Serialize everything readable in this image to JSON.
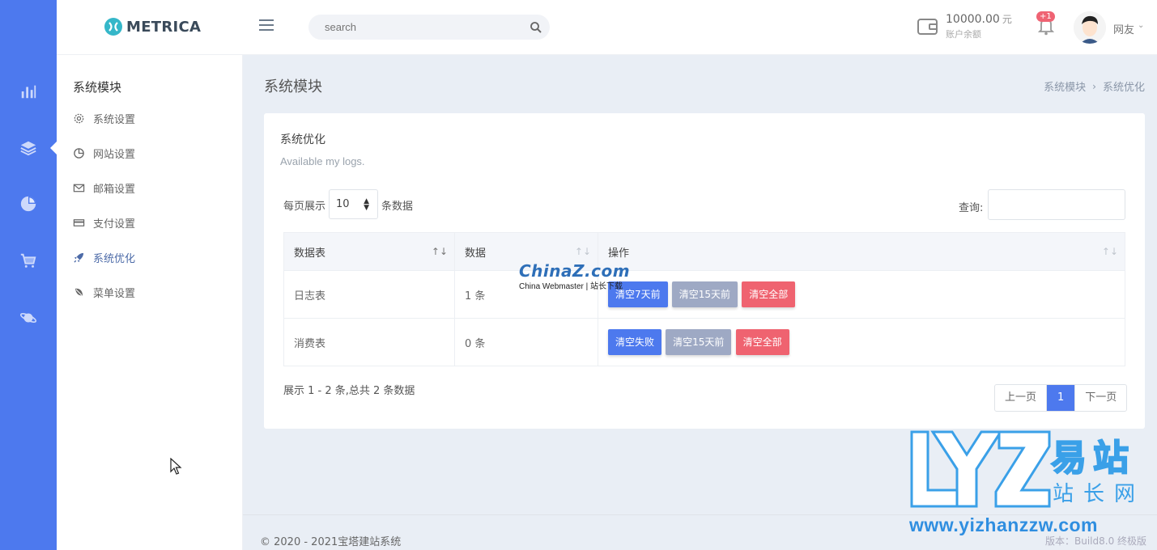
{
  "app": {
    "logo_text": "METRICA"
  },
  "rail": {
    "items": [
      {
        "icon": "bar-chart-icon"
      },
      {
        "icon": "layers-icon"
      },
      {
        "icon": "pie-chart-icon"
      },
      {
        "icon": "cart-icon"
      },
      {
        "icon": "planet-icon"
      }
    ]
  },
  "header": {
    "search_placeholder": "search",
    "balance_amount": "10000.00",
    "balance_unit": "元",
    "balance_label": "账户余额",
    "notification_badge": "+1",
    "user_name": "网友",
    "user_caret": "⌄"
  },
  "sidebar": {
    "title": "系统模块",
    "items": [
      {
        "label": "系统设置",
        "icon": "gear-icon"
      },
      {
        "label": "网站设置",
        "icon": "chart-pie-icon"
      },
      {
        "label": "邮箱设置",
        "icon": "mail-icon"
      },
      {
        "label": "支付设置",
        "icon": "card-icon"
      },
      {
        "label": "系统优化",
        "icon": "rocket-icon",
        "active": true
      },
      {
        "label": "菜单设置",
        "icon": "leaf-icon"
      }
    ]
  },
  "page": {
    "title": "系统模块",
    "breadcrumb": [
      "系统模块",
      "系统优化"
    ]
  },
  "card": {
    "title": "系统优化",
    "subtitle": "Available my logs.",
    "per_page_prefix": "每页展示",
    "per_page_value": "10",
    "per_page_suffix": "条数据",
    "query_label": "查询:",
    "columns": [
      "数据表",
      "数据",
      "操作"
    ],
    "rows": [
      {
        "table": "日志表",
        "count": "1 条",
        "actions": [
          "清空7天前",
          "清空15天前",
          "清空全部"
        ]
      },
      {
        "table": "消费表",
        "count": "0 条",
        "actions": [
          "清空失败",
          "清空15天前",
          "清空全部"
        ]
      }
    ],
    "summary": "展示 1 - 2 条,总共 2 条数据",
    "pager": {
      "prev": "上一页",
      "current": "1",
      "next": "下一页"
    }
  },
  "footer": {
    "copyright": "© 2020 - 2021宝塔建站系统",
    "version": "版本：Build8.0 终极版"
  },
  "watermarks": {
    "chinaz_big": "ChinaZ.com",
    "chinaz_small": "China Webmaster | 站长下载",
    "yz_cn1": "易站",
    "yz_cn2": "站长网",
    "yz_url": "www.yizhanzzw.com"
  },
  "colors": {
    "accent": "#4d79ee",
    "gray_button": "#9ea9c4",
    "danger": "#ef6370"
  }
}
